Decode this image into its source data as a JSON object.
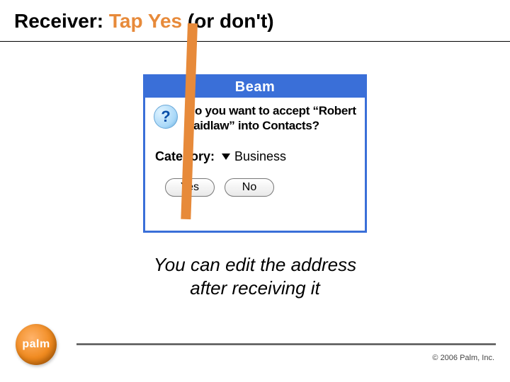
{
  "heading": {
    "part1": "Receiver: ",
    "part2": "Tap Yes",
    "part3": " (or don't)"
  },
  "dialog": {
    "title": "Beam",
    "question_icon": "?",
    "question": "Do you want to accept “Robert Laidlaw” into Contacts?",
    "category_label": "Category:",
    "category_value": "Business",
    "yes_label": "Yes",
    "no_label": "No"
  },
  "caption": {
    "line1": "You can edit the address",
    "line2": "after receiving it"
  },
  "footer": {
    "logo_text": "palm",
    "copyright": "© 2006 Palm, Inc."
  }
}
